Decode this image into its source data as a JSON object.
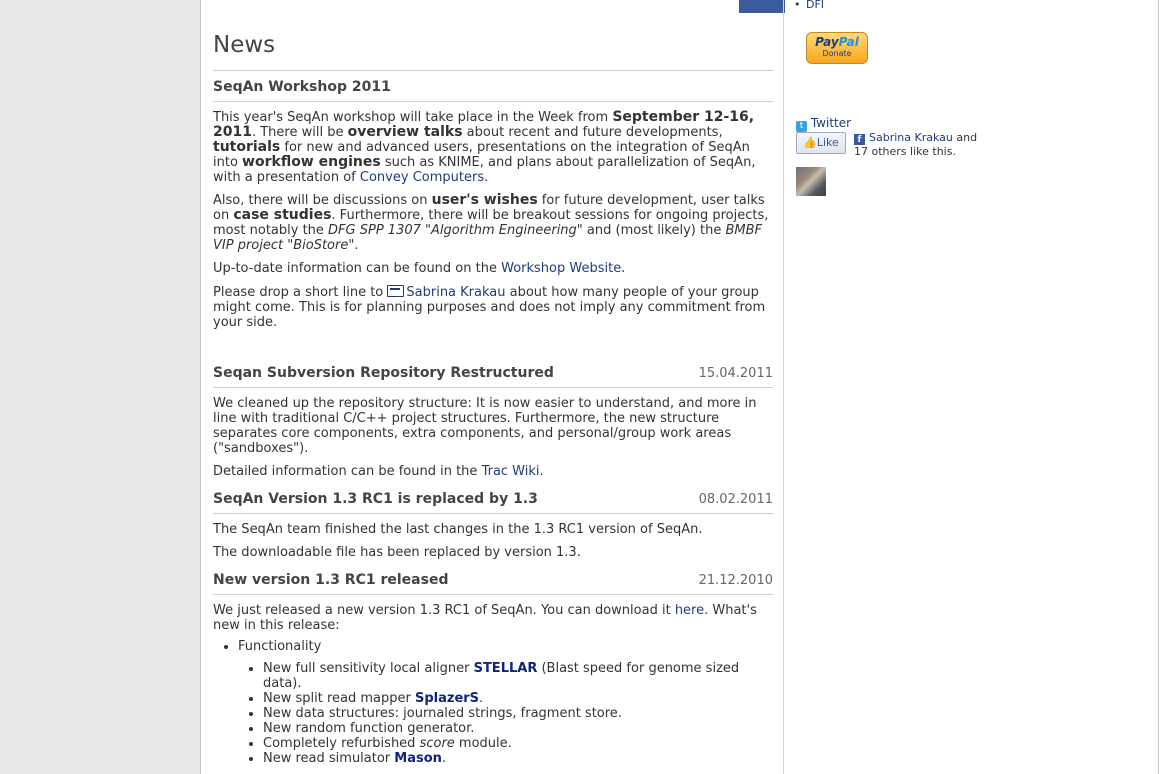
{
  "main": {
    "heading": "News",
    "posts": [
      {
        "title": "SeqAn Workshop 2011",
        "date": "",
        "p1": {
          "a": "This year's SeqAn workshop will take place in the Week from ",
          "b": "September 12-16, 2011",
          "c": ". There will be ",
          "d": "overview talks",
          "e": " about recent and future developments, ",
          "f": "tutorials",
          "g": " for new and advanced users, presentations on the integration of SeqAn into ",
          "h": "workflow engines",
          "i": " such as KNIME, and plans about parallelization of SeqAn, with a presentation of ",
          "link": "Convey Computers",
          "j": "."
        },
        "p2": {
          "a": "Also, there will be discussions on ",
          "b": "user's wishes",
          "c": " for future development, user talks on ",
          "d": "case studies",
          "e": ". Furthermore, there will be breakout sessions for ongoing projects, most notably the ",
          "f": "DFG SPP 1307 \"Algorithm Engineering\"",
          "g": " and (most likely) the ",
          "h": "BMBF VIP project \"BioStore\"",
          "i": "."
        },
        "p3": {
          "a": "Up-to-date information can be found on the ",
          "link": "Workshop Website",
          "b": "."
        },
        "p4": {
          "a": "Please drop a short line to ",
          "link": "Sabrina Krakau",
          "b": " about how many people of your group might come. This is for planning purposes and does not imply any commitment from your side."
        }
      },
      {
        "title": "Seqan Subversion Repository Restructured",
        "date": "15.04.2011",
        "p1": "We cleaned up the repository structure: It is now easier to understand, and more in line with traditional C/C++ project structures. Furthermore, the new structure separates core components, extra components, and personal/group work areas (\"sandboxes\").",
        "p2": {
          "a": "Detailed information can be found in the ",
          "link": "Trac Wiki",
          "b": "."
        }
      },
      {
        "title": "SeqAn Version 1.3 RC1 is replaced by 1.3",
        "date": "08.02.2011",
        "p1": "The SeqAn team finished the last changes in the 1.3 RC1 version of SeqAn.",
        "p2": "The downloadable file has been replaced by version 1.3."
      },
      {
        "title": "New version 1.3 RC1 released",
        "date": "21.12.2010",
        "p1": {
          "a": "We just released a new version 1.3 RC1 of SeqAn. You can download it ",
          "link": "here",
          "b": ". What's new in this release:"
        },
        "list_title": "Functionality",
        "items": [
          {
            "a": "New full sensitivity local aligner ",
            "b": "STELLAR",
            "c": " (Blast speed for genome sized data)."
          },
          {
            "a": "New split read mapper ",
            "b": "SplazerS",
            "c": "."
          },
          {
            "a": "New data structures: journaled strings, fragment store.",
            "b": "",
            "c": ""
          },
          {
            "a": "New random function generator.",
            "b": "",
            "c": ""
          },
          {
            "a": "Completely refurbished ",
            "i": "score",
            "c": " module."
          },
          {
            "a": "New read simulator ",
            "b": "Mason",
            "c": "."
          }
        ]
      }
    ]
  },
  "sidebar": {
    "dfi": "DFI",
    "paypal_logo_a": "Pay",
    "paypal_logo_b": "Pal",
    "donate": "Donate",
    "twitter": "Twitter",
    "like": "Like",
    "fb_person": "Sabrina Krakau",
    "fb_text": " and 17 others like this."
  },
  "colors": {
    "link": "#1f3d7a",
    "paypal": "#f7a51d",
    "facebook": "#3b5998",
    "twitter": "#3aa4d8"
  }
}
